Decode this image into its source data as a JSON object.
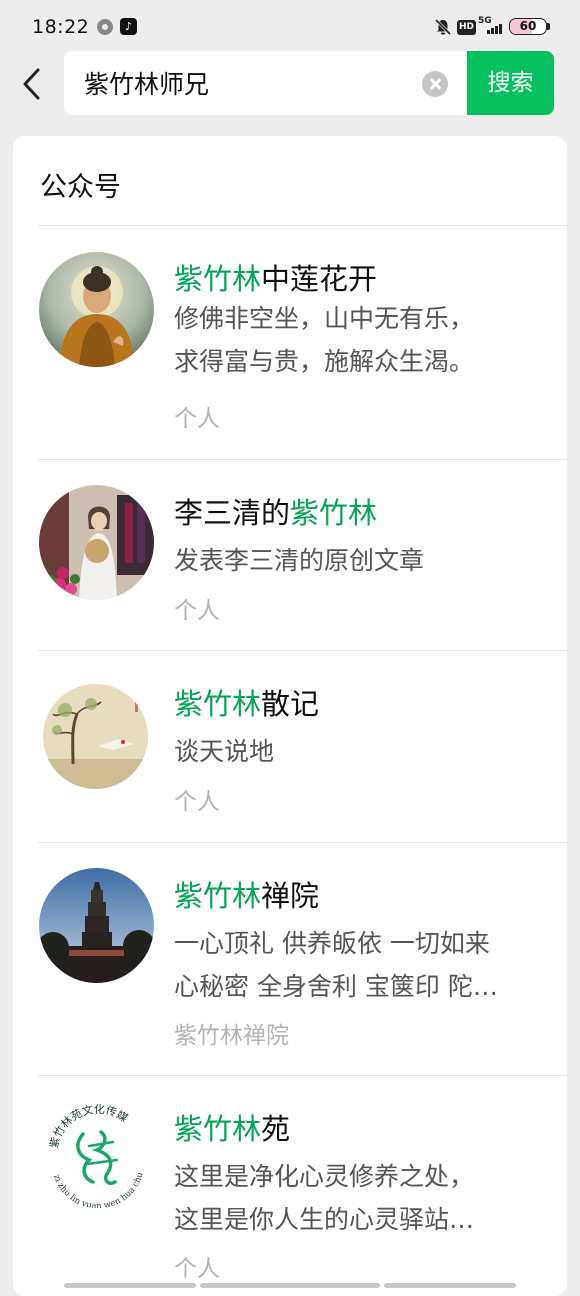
{
  "status_bar": {
    "time": "18:22",
    "hd": "HD",
    "network": "5G",
    "battery": "60",
    "battery_level": 0.6
  },
  "search": {
    "query": "紫竹林师兄",
    "button_label": "搜索"
  },
  "section": {
    "title": "公众号"
  },
  "results": [
    {
      "name_highlight": "紫竹林",
      "name_rest": "中莲花开",
      "desc_lines": [
        "修佛非空坐，山中无有乐，",
        "求得富与贵，施解众生渴。"
      ],
      "meta": "个人"
    },
    {
      "name_prefix": "李三清的",
      "name_highlight": "紫竹林",
      "desc_lines": [
        "发表李三清的原创文章"
      ],
      "meta": "个人"
    },
    {
      "name_highlight": "紫竹林",
      "name_rest": "散记",
      "desc_lines": [
        "谈天说地"
      ],
      "meta": "个人"
    },
    {
      "name_highlight": "紫竹林",
      "name_rest": "禅院",
      "desc_lines": [
        "一心顶礼 供养皈依 一切如来",
        "心秘密 全身舍利 宝箧印 陀…"
      ],
      "meta": "紫竹林禅院"
    },
    {
      "name_highlight": "紫竹林",
      "name_rest": "苑",
      "desc_lines": [
        "这里是净化心灵修养之处，",
        "这里是你人生的心灵驿站…"
      ],
      "meta": "个人",
      "logo_text": "紫竹林苑文化传媒",
      "logo_pinyin": "zi zhu lin yuan wen hua chuan mei"
    }
  ],
  "colors": {
    "accent": "#07c160",
    "highlight": "#07a35a"
  }
}
